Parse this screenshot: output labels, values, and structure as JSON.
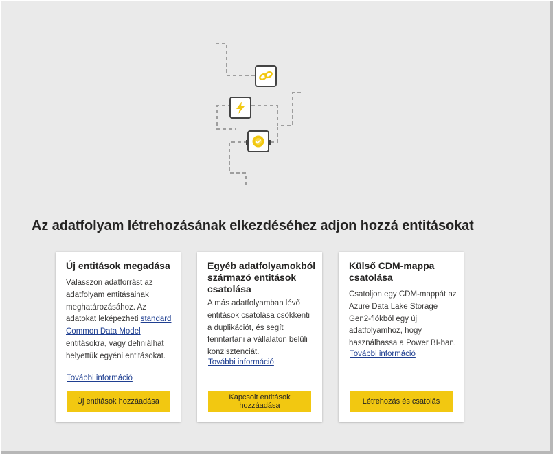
{
  "heading": "Az adatfolyam létrehozásának elkezdéséhez adjon hozzá entitásokat",
  "illustration": {
    "icons": [
      "link-icon",
      "lightning-icon",
      "certified-badge-icon"
    ],
    "accent_color": "#f2c811"
  },
  "cards": [
    {
      "title": "Új entitások megadása",
      "desc_before": "Válasszon adatforrást az adatfolyam entitásainak meghatározásához. Az adatokat leképezheti ",
      "desc_link": "standard Common Data Model",
      "desc_after": " entitásokra, vagy definiálhat helyettük egyéni entitásokat.",
      "more_link": "További információ",
      "button": "Új entitások hozzáadása"
    },
    {
      "title": "Egyéb adatfolyamokból származó entitások csatolása",
      "desc": "A más adatfolyamban lévő entitások csatolása csökkenti a duplikációt, és segít fenntartani a vállalaton belüli konzisztenciát.",
      "more_link": "További információ",
      "button": "Kapcsolt entitások hozzáadása"
    },
    {
      "title": "Külső CDM-mappa csatolása",
      "desc": "Csatoljon egy CDM-mappát az Azure Data Lake Storage Gen2-fiókból egy új adatfolyamhoz, hogy használhassa a Power BI-ban.",
      "more_link": "További információ",
      "button": "Létrehozás és csatolás"
    }
  ],
  "colors": {
    "background": "#eaeaea",
    "card": "#ffffff",
    "button": "#f2c811",
    "link": "#1f3f91"
  }
}
